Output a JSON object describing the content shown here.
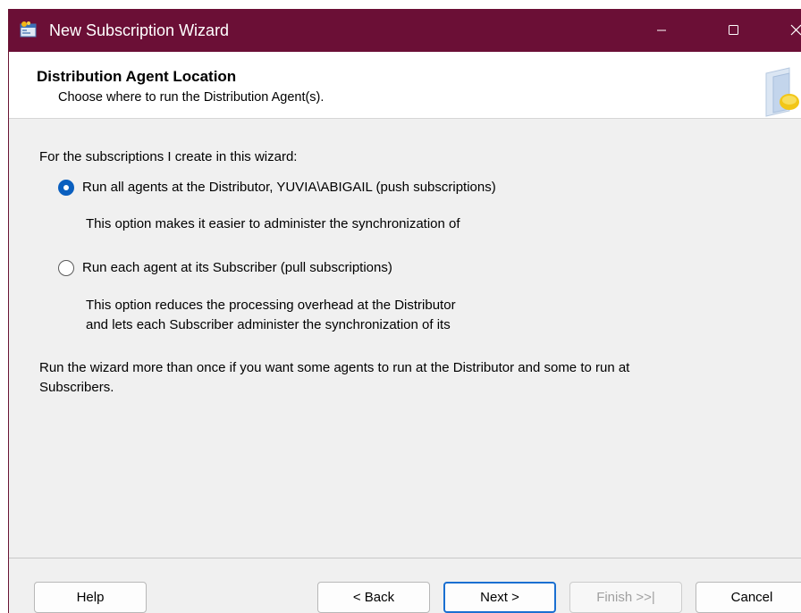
{
  "window": {
    "title": "New Subscription Wizard",
    "titlebar_color": "#6b0f36",
    "minimize_icon": "minimize-icon",
    "maximize_icon": "maximize-icon",
    "close_icon": "close-icon"
  },
  "header": {
    "title": "Distribution Agent Location",
    "subtitle": "Choose where to run the Distribution Agent(s)."
  },
  "content": {
    "intro": "For the subscriptions I create in this wizard:",
    "options": [
      {
        "label": "Run all agents at the Distributor, YUVIA\\ABIGAIL (push subscriptions)",
        "checked": true,
        "description": [
          "This option makes it easier to administer the synchronization of"
        ]
      },
      {
        "label": "Run each agent at its Subscriber (pull subscriptions)",
        "checked": false,
        "description": [
          "This option reduces the processing overhead at the Distributor",
          "and lets each Subscriber administer the synchronization of its"
        ]
      }
    ],
    "note_line1": "Run the wizard more than once if you want some agents to run at the Distributor and some to run at",
    "note_line2": "Subscribers."
  },
  "buttons": {
    "help": "Help",
    "back": "< Back",
    "next": "Next >",
    "finish": "Finish >>|",
    "cancel": "Cancel"
  },
  "colors": {
    "accent": "#0a5fbf",
    "default_button_border": "#1a6fd1"
  }
}
